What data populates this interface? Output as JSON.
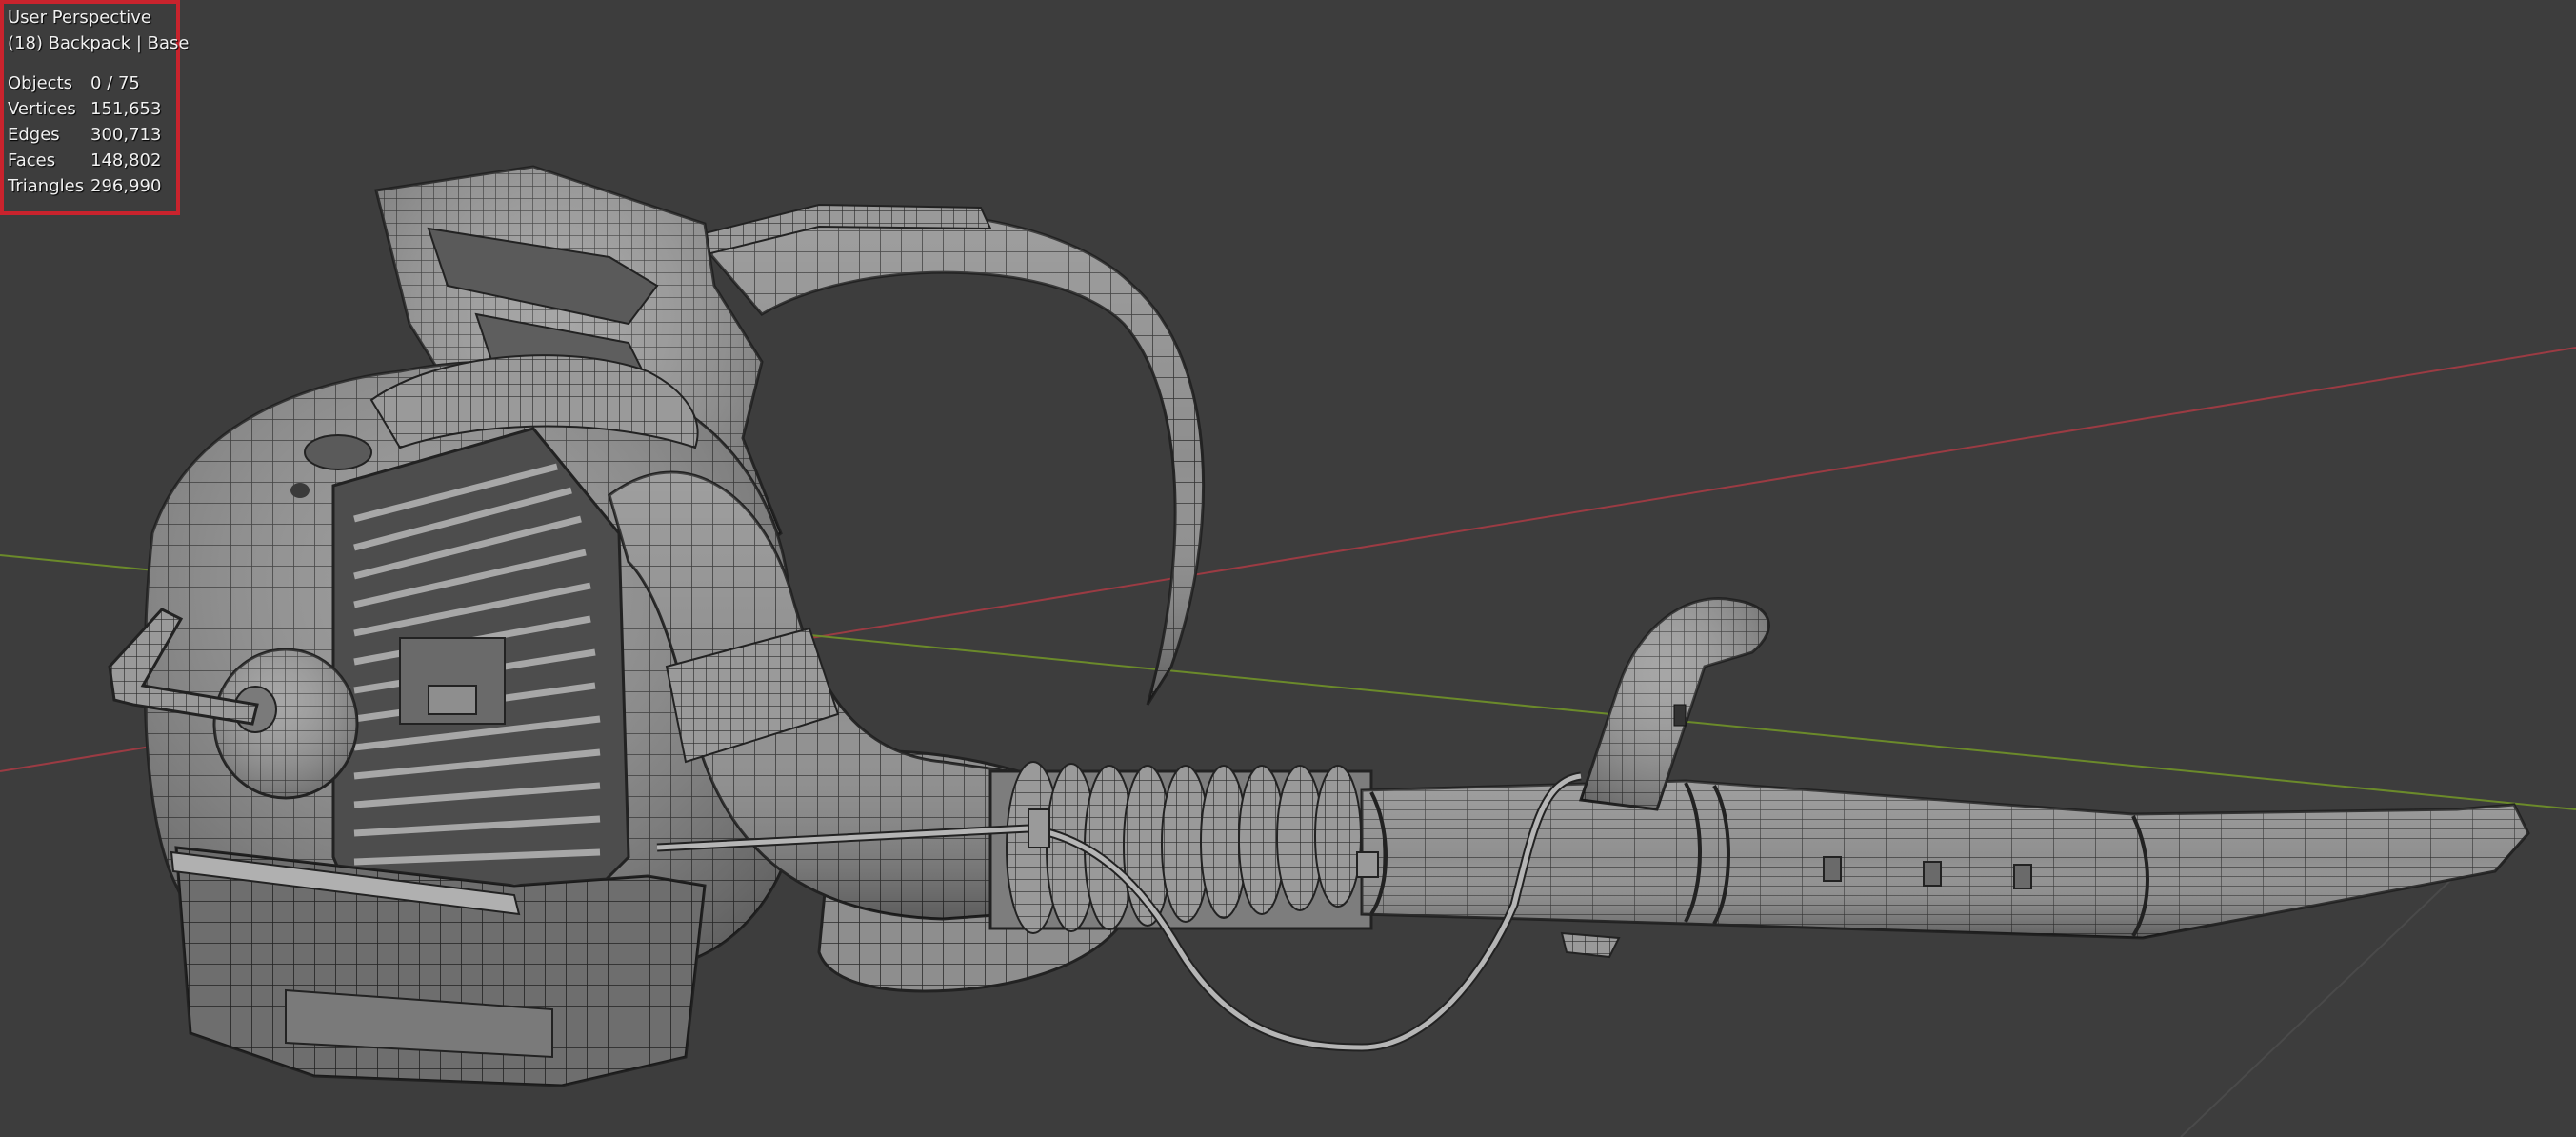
{
  "viewport": {
    "view_name": "User Perspective",
    "context": "(18) Backpack | Base",
    "stats": [
      {
        "label": "Objects",
        "value": "0 / 75"
      },
      {
        "label": "Vertices",
        "value": "151,653"
      },
      {
        "label": "Edges",
        "value": "300,713"
      },
      {
        "label": "Faces",
        "value": "148,802"
      },
      {
        "label": "Triangles",
        "value": "296,990"
      }
    ]
  },
  "colors": {
    "background": "#3d3d3d",
    "x_axis": "#9b3b43",
    "y_axis": "#6b8a2a",
    "highlight_border": "#c9232d",
    "mesh_fill": "#8c8c8c",
    "wire": "#2a2a2a"
  }
}
